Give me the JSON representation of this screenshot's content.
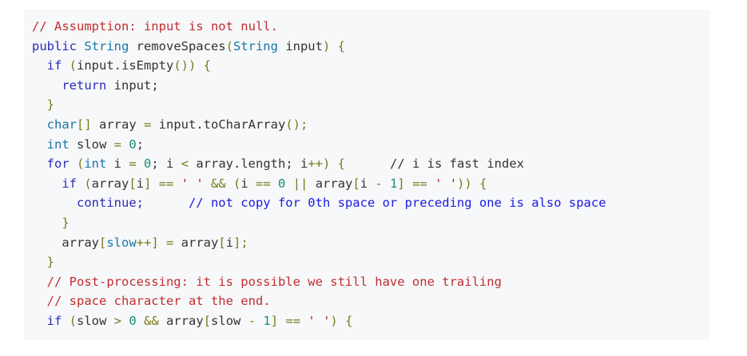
{
  "code": {
    "language": "java",
    "colors": {
      "background": "#f6f8fa",
      "comment": "#c32d2d",
      "comment_inline": "#1a1ae0",
      "keyword": "#2a2ab8",
      "type": "#1a75a6",
      "string": "#b81f1f",
      "number": "#1a8a76",
      "operator": "#7a7a1a",
      "plain": "#333333"
    },
    "lines": [
      [
        {
          "t": "// Assumption: input is not null.",
          "c": "comment"
        }
      ],
      [
        {
          "t": "public ",
          "c": "kw"
        },
        {
          "t": "String ",
          "c": "type"
        },
        {
          "t": "removeSpaces",
          "c": "plain"
        },
        {
          "t": "(",
          "c": "op"
        },
        {
          "t": "String ",
          "c": "type"
        },
        {
          "t": "input",
          "c": "plain"
        },
        {
          "t": ") {",
          "c": "op"
        }
      ],
      [
        {
          "t": "  if ",
          "c": "kw"
        },
        {
          "t": "(",
          "c": "op"
        },
        {
          "t": "input.isEmpty",
          "c": "plain"
        },
        {
          "t": "()) {",
          "c": "op"
        }
      ],
      [
        {
          "t": "    return ",
          "c": "kw"
        },
        {
          "t": "input;",
          "c": "plain"
        }
      ],
      [
        {
          "t": "  }",
          "c": "op"
        }
      ],
      [
        {
          "t": "  char",
          "c": "type"
        },
        {
          "t": "[] ",
          "c": "op"
        },
        {
          "t": "array ",
          "c": "plain"
        },
        {
          "t": "= ",
          "c": "op"
        },
        {
          "t": "input.toCharArray",
          "c": "plain"
        },
        {
          "t": "();",
          "c": "op"
        }
      ],
      [
        {
          "t": "  int ",
          "c": "type"
        },
        {
          "t": "slow ",
          "c": "plain"
        },
        {
          "t": "= ",
          "c": "op"
        },
        {
          "t": "0",
          "c": "num"
        },
        {
          "t": ";",
          "c": "plain"
        }
      ],
      [
        {
          "t": "  for ",
          "c": "kw"
        },
        {
          "t": "(",
          "c": "op"
        },
        {
          "t": "int ",
          "c": "type"
        },
        {
          "t": "i ",
          "c": "plain"
        },
        {
          "t": "= ",
          "c": "op"
        },
        {
          "t": "0",
          "c": "num"
        },
        {
          "t": "; i ",
          "c": "plain"
        },
        {
          "t": "< ",
          "c": "op"
        },
        {
          "t": "array.length; i",
          "c": "plain"
        },
        {
          "t": "++",
          "c": "op"
        },
        {
          "t": ") {",
          "c": "op"
        },
        {
          "t": "      // i is fast index",
          "c": "plain"
        }
      ],
      [
        {
          "t": "    if ",
          "c": "kw"
        },
        {
          "t": "(",
          "c": "op"
        },
        {
          "t": "array",
          "c": "plain"
        },
        {
          "t": "[",
          "c": "op"
        },
        {
          "t": "i",
          "c": "plain"
        },
        {
          "t": "] == ",
          "c": "op"
        },
        {
          "t": "' '",
          "c": "str"
        },
        {
          "t": " && (",
          "c": "op"
        },
        {
          "t": "i ",
          "c": "plain"
        },
        {
          "t": "== ",
          "c": "op"
        },
        {
          "t": "0",
          "c": "num"
        },
        {
          "t": " || ",
          "c": "op"
        },
        {
          "t": "array",
          "c": "plain"
        },
        {
          "t": "[",
          "c": "op"
        },
        {
          "t": "i ",
          "c": "plain"
        },
        {
          "t": "- ",
          "c": "op"
        },
        {
          "t": "1",
          "c": "num"
        },
        {
          "t": "] == ",
          "c": "op"
        },
        {
          "t": "' '",
          "c": "str"
        },
        {
          "t": ")) {",
          "c": "op"
        }
      ],
      [
        {
          "t": "      continue;",
          "c": "kw"
        },
        {
          "t": "      // not copy for 0th space or preceding one is also space",
          "c": "comment-blue"
        }
      ],
      [
        {
          "t": "    }",
          "c": "op"
        }
      ],
      [
        {
          "t": "    array",
          "c": "plain"
        },
        {
          "t": "[",
          "c": "op"
        },
        {
          "t": "slow",
          "c": "type"
        },
        {
          "t": "++",
          "c": "op"
        },
        {
          "t": "] = ",
          "c": "op"
        },
        {
          "t": "array",
          "c": "plain"
        },
        {
          "t": "[",
          "c": "op"
        },
        {
          "t": "i",
          "c": "plain"
        },
        {
          "t": "];",
          "c": "op"
        }
      ],
      [
        {
          "t": "  }",
          "c": "op"
        }
      ],
      [
        {
          "t": "  // Post-processing: it is possible we still have one trailing",
          "c": "comment"
        }
      ],
      [
        {
          "t": "  // space character at the end.",
          "c": "comment"
        }
      ],
      [
        {
          "t": "  if ",
          "c": "kw"
        },
        {
          "t": "(",
          "c": "op"
        },
        {
          "t": "slow ",
          "c": "plain"
        },
        {
          "t": "> ",
          "c": "op"
        },
        {
          "t": "0",
          "c": "num"
        },
        {
          "t": " && ",
          "c": "op"
        },
        {
          "t": "array",
          "c": "plain"
        },
        {
          "t": "[",
          "c": "op"
        },
        {
          "t": "slow ",
          "c": "plain"
        },
        {
          "t": "- ",
          "c": "op"
        },
        {
          "t": "1",
          "c": "num"
        },
        {
          "t": "] == ",
          "c": "op"
        },
        {
          "t": "' '",
          "c": "str"
        },
        {
          "t": ") {",
          "c": "op"
        }
      ]
    ]
  }
}
